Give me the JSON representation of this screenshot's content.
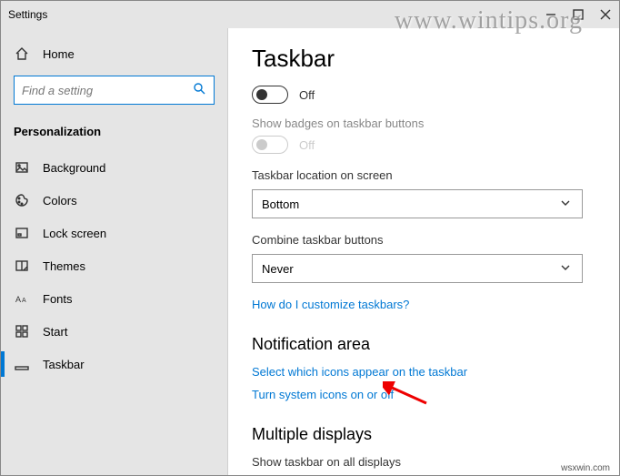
{
  "window": {
    "title": "Settings"
  },
  "sidebar": {
    "home": "Home",
    "search_placeholder": "Find a setting",
    "section_heading": "Personalization",
    "items": [
      {
        "label": "Background"
      },
      {
        "label": "Colors"
      },
      {
        "label": "Lock screen"
      },
      {
        "label": "Themes"
      },
      {
        "label": "Fonts"
      },
      {
        "label": "Start"
      },
      {
        "label": "Taskbar"
      }
    ]
  },
  "main": {
    "heading": "Taskbar",
    "toggle1": {
      "state": "Off"
    },
    "badges_label": "Show badges on taskbar buttons",
    "toggle2": {
      "state": "Off"
    },
    "location_label": "Taskbar location on screen",
    "location_value": "Bottom",
    "combine_label": "Combine taskbar buttons",
    "combine_value": "Never",
    "customize_link": "How do I customize taskbars?",
    "notification_heading": "Notification area",
    "select_icons_link": "Select which icons appear on the taskbar",
    "system_icons_link": "Turn system icons on or off",
    "multiple_heading": "Multiple displays",
    "multiple_sublabel": "Show taskbar on all displays"
  },
  "watermarks": {
    "url": "www.wintips.org",
    "source": "wsxwin.com"
  }
}
